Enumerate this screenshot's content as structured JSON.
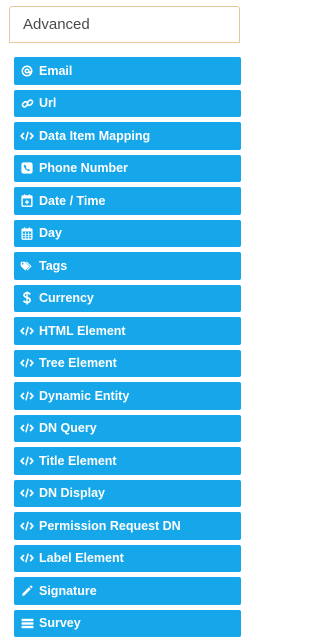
{
  "panel": {
    "title": "Advanced",
    "items": [
      {
        "label": "Email",
        "icon": "at-icon"
      },
      {
        "label": "Url",
        "icon": "link-icon"
      },
      {
        "label": "Data Item Mapping",
        "icon": "code-icon"
      },
      {
        "label": "Phone Number",
        "icon": "phone-icon"
      },
      {
        "label": "Date / Time",
        "icon": "calendar-plus-icon"
      },
      {
        "label": "Day",
        "icon": "calendar-icon"
      },
      {
        "label": "Tags",
        "icon": "tag-icon"
      },
      {
        "label": "Currency",
        "icon": "dollar-icon"
      },
      {
        "label": "HTML Element",
        "icon": "code-icon"
      },
      {
        "label": "Tree Element",
        "icon": "code-icon"
      },
      {
        "label": "Dynamic Entity",
        "icon": "code-icon"
      },
      {
        "label": "DN Query",
        "icon": "code-icon"
      },
      {
        "label": "Title Element",
        "icon": "code-icon"
      },
      {
        "label": "DN Display",
        "icon": "code-icon"
      },
      {
        "label": "Permission Request DN",
        "icon": "code-icon"
      },
      {
        "label": "Label Element",
        "icon": "code-icon"
      },
      {
        "label": "Signature",
        "icon": "pencil-icon"
      },
      {
        "label": "Survey",
        "icon": "list-icon"
      }
    ]
  },
  "colors": {
    "item_background": "#15a7ea",
    "item_text": "#ffffff",
    "header_border": "#e8c89a"
  }
}
